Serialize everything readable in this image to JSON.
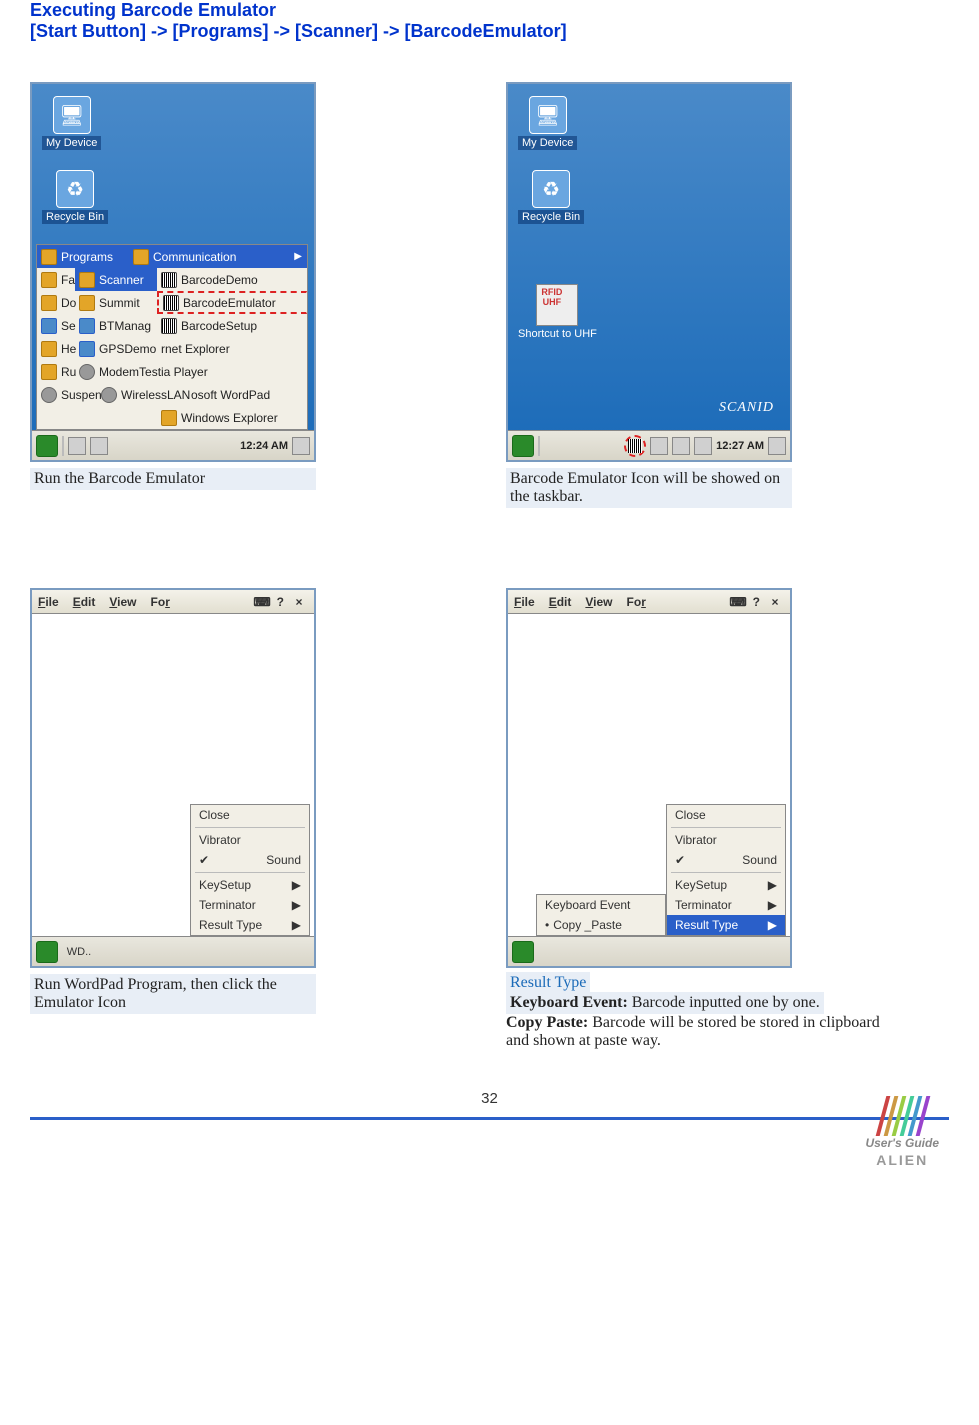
{
  "headings": {
    "line1": "Executing Barcode Emulator",
    "line2": "[Start Button] -> [Programs] -> [Scanner] -> [BarcodeEmulator]"
  },
  "desktop": {
    "my_device": "My Device",
    "recycle_bin": "Recycle Bin",
    "shortcut_uhf": "Shortcut to UHF",
    "scanid": "SCANID"
  },
  "start_menu": {
    "programs": "Programs",
    "communication": "Communication",
    "fa": "Fa",
    "scanner": "Scanner",
    "barcode_demo": "BarcodeDemo",
    "do": "Do",
    "summit": "Summit",
    "barcode_emulator": "BarcodeEmulator",
    "se": "Se",
    "btmanag": "BTManag",
    "barcode_setup": "BarcodeSetup",
    "he": "He",
    "gpsdemo": "GPSDemo",
    "rnet_explorer": "rnet Explorer",
    "ru": "Ru",
    "modemtest": "ModemTest",
    "ia_player": "ia Player",
    "suspend": "Suspend",
    "wirelesslan": "WirelessLAN",
    "soft_wordpad": "osoft WordPad",
    "windows_explorer": "Windows Explorer"
  },
  "taskbar": {
    "time1": "12:24 AM",
    "time2": "12:27 AM"
  },
  "captions": {
    "c1": "Run the Barcode Emulator",
    "c2": "Barcode Emulator Icon will be showed on the taskbar.",
    "c3": "Run WordPad Program, then click the Emulator Icon",
    "result_type": "Result Type",
    "kb_event_label": "Keyboard Event: ",
    "kb_event_text": "Barcode inputted one by one.",
    "copy_paste_label": "Copy Paste: ",
    "copy_paste_text": "Barcode will be stored be stored in clipboard and shown at paste way."
  },
  "wordpad": {
    "file": "File",
    "edit": "Edit",
    "view": "View",
    "for": "For",
    "close": "Close",
    "vibrator": "Vibrator",
    "sound": "Sound",
    "keysetup": "KeySetup",
    "terminator": "Terminator",
    "result_type": "Result Type",
    "keyboard_event": "Keyboard Event",
    "copy_paste": "Copy _Paste",
    "wd": "D.."
  },
  "footer": {
    "page": "32",
    "guide": "User's Guide",
    "brand": "ALIEN"
  }
}
